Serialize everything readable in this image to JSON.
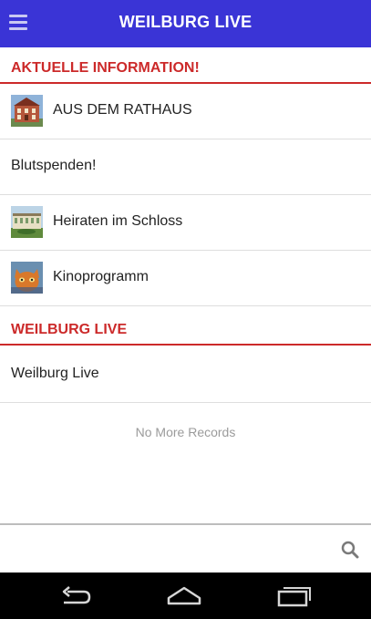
{
  "appbar": {
    "title": "WEILBURG LIVE",
    "menu_icon": "hamburger-menu-icon"
  },
  "sections": [
    {
      "header": "AKTUELLE INFORMATION!",
      "items": [
        {
          "label": "AUS DEM RATHAUS",
          "thumbnail": "townhall-image"
        },
        {
          "label": "Blutspenden!",
          "thumbnail": ""
        },
        {
          "label": "Heiraten im Schloss",
          "thumbnail": "castle-image"
        },
        {
          "label": "Kinoprogramm",
          "thumbnail": "cinema-image"
        }
      ]
    },
    {
      "header": "WEILBURG LIVE",
      "items": [
        {
          "label": "Weilburg Live",
          "thumbnail": ""
        }
      ]
    }
  ],
  "list_footer": "No More Records",
  "search": {
    "icon": "search-icon",
    "placeholder": ""
  },
  "navbar": {
    "back_icon": "back-icon",
    "home_icon": "home-icon",
    "recents_icon": "recents-icon"
  },
  "colors": {
    "appbar": "#3a34d6",
    "section_header": "#cc2a2a",
    "navbar": "#000000"
  }
}
